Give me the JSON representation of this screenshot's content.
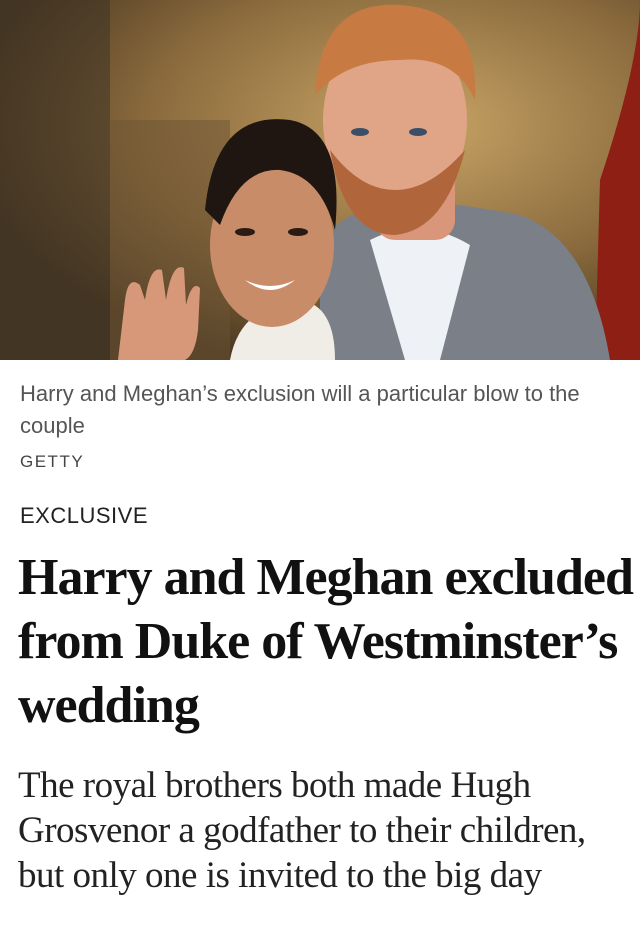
{
  "hero_image": {
    "alt_icon": "photo-image"
  },
  "caption": "Harry and Meghan’s exclusion will a particular blow to the couple",
  "credit": "GETTY",
  "kicker": "EXCLUSIVE",
  "headline": "Harry and Meghan excluded from Duke of Westminster’s wedding",
  "standfirst": "The royal brothers both made Hugh Grosvenor a godfather to their children, but only one is invited to the big day"
}
